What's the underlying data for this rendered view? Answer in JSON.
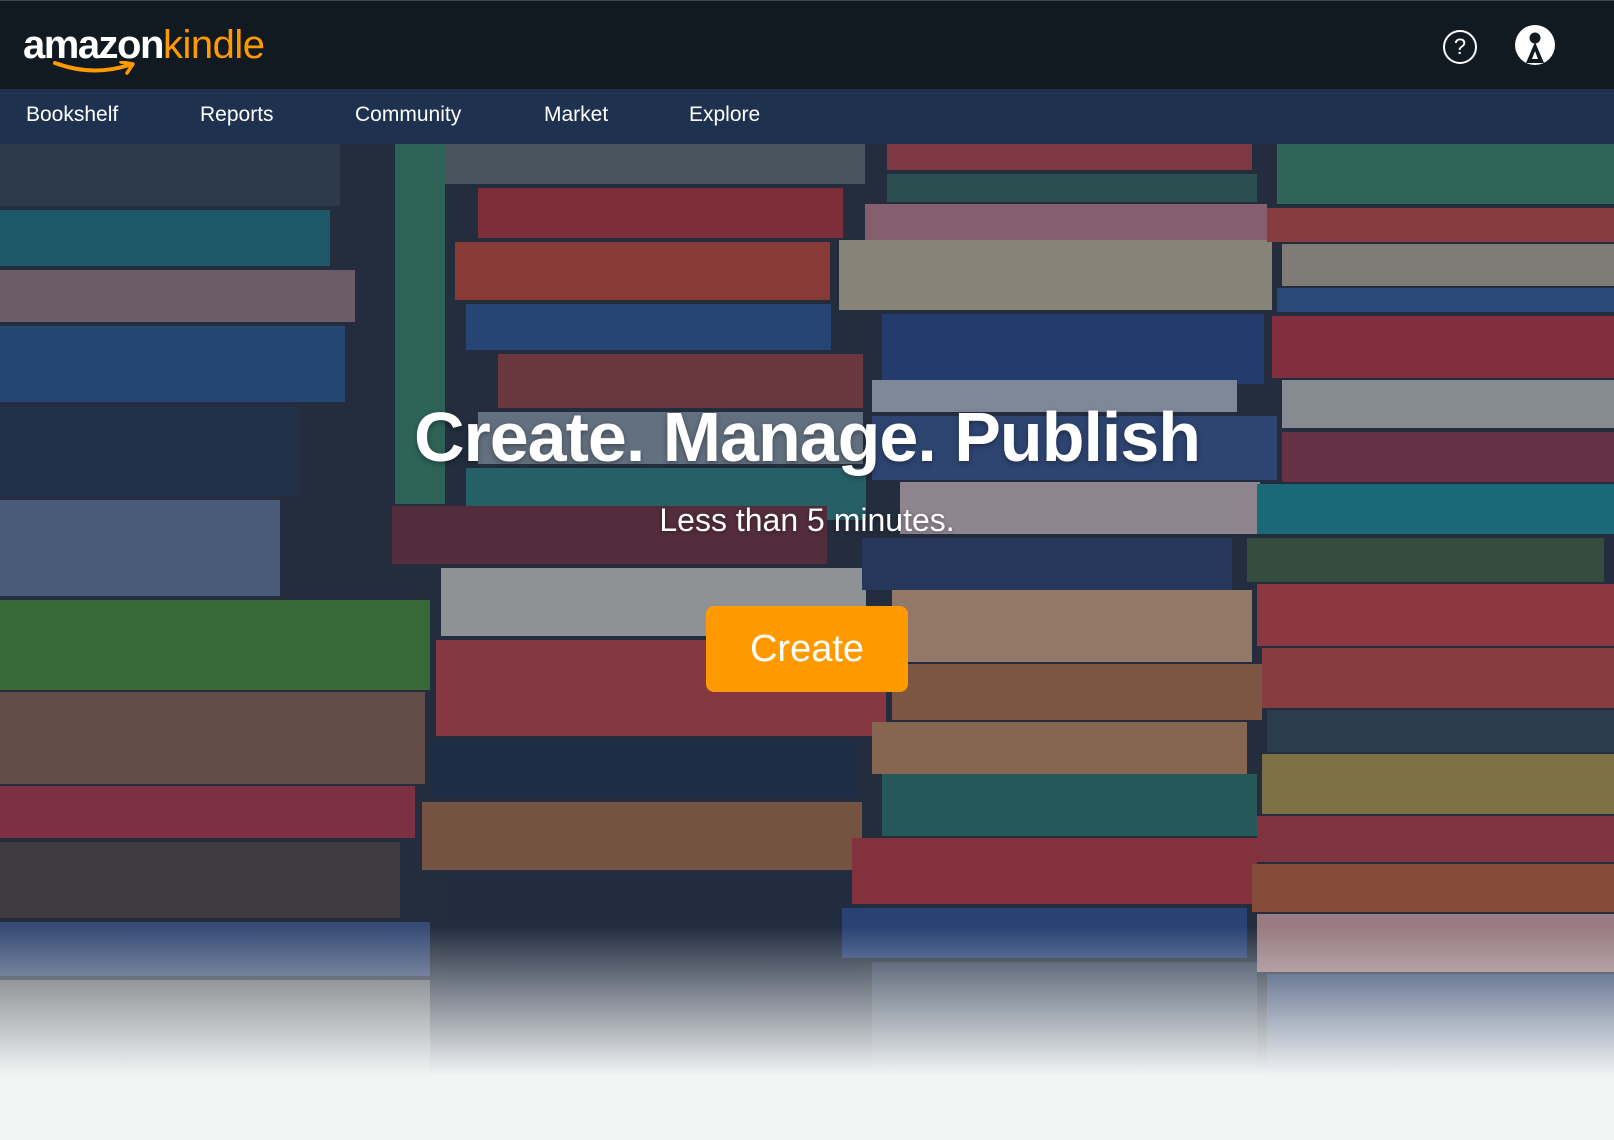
{
  "header": {
    "logo_primary": "amazon",
    "logo_secondary": "kindle",
    "help_glyph": "?",
    "help_icon": "help-circle-icon",
    "account_icon": "user-avatar-icon"
  },
  "nav": {
    "items": [
      {
        "label": "Bookshelf"
      },
      {
        "label": "Reports"
      },
      {
        "label": "Community"
      },
      {
        "label": "Market"
      },
      {
        "label": "Explore"
      }
    ]
  },
  "hero": {
    "title": "Create. Manage. Publish",
    "subtitle": "Less than 5 minutes.",
    "cta_label": "Create",
    "background": "bookshelf-photo"
  },
  "colors": {
    "topbar": "#111921",
    "navbar": "#1e3250",
    "accent": "#ff9900",
    "page_bg": "#f2f4f4"
  }
}
